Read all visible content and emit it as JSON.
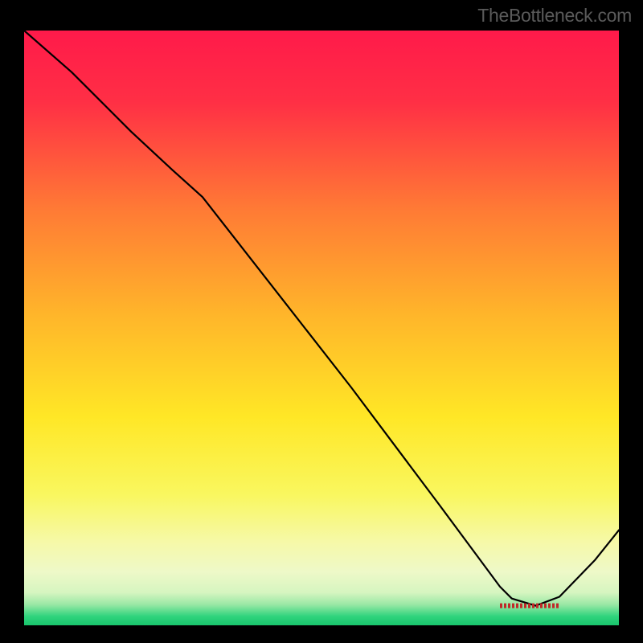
{
  "watermark": "TheBottleneck.com",
  "chart_data": {
    "type": "line",
    "title": "",
    "xlabel": "",
    "ylabel": "",
    "xlim": [
      0,
      100
    ],
    "ylim": [
      0,
      100
    ],
    "grid": false,
    "axes_visible": false,
    "background_gradient": {
      "type": "vertical",
      "stops": [
        {
          "pos": 0.0,
          "color": "#ff1a4a"
        },
        {
          "pos": 0.12,
          "color": "#ff2f45"
        },
        {
          "pos": 0.3,
          "color": "#ff7a35"
        },
        {
          "pos": 0.48,
          "color": "#ffb62a"
        },
        {
          "pos": 0.65,
          "color": "#ffe726"
        },
        {
          "pos": 0.78,
          "color": "#f9f75f"
        },
        {
          "pos": 0.86,
          "color": "#f6f9a8"
        },
        {
          "pos": 0.91,
          "color": "#eef9c8"
        },
        {
          "pos": 0.945,
          "color": "#d6f5c0"
        },
        {
          "pos": 0.965,
          "color": "#9ae8a5"
        },
        {
          "pos": 0.985,
          "color": "#2fd47d"
        },
        {
          "pos": 1.0,
          "color": "#19c46c"
        }
      ]
    },
    "series": [
      {
        "name": "bottleneck-curve",
        "color": "#000000",
        "stroke_width": 2.2,
        "x": [
          0,
          8,
          18,
          25,
          30,
          55,
          70,
          80,
          82,
          86,
          90,
          96,
          100
        ],
        "y": [
          100,
          93,
          83,
          76.5,
          72,
          40,
          20,
          6.5,
          4.5,
          3.3,
          4.8,
          11,
          16
        ]
      }
    ],
    "flat_segment": {
      "x_start": 80,
      "x_end": 90,
      "y": 3.3,
      "label": "",
      "label_color": "#c02828"
    }
  }
}
